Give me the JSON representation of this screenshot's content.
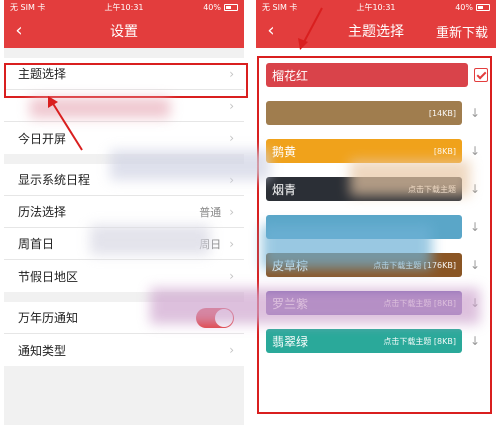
{
  "status": {
    "carrier": "无 SIM 卡",
    "time": "上午10:31",
    "battery": "40%"
  },
  "left": {
    "title": "设置",
    "groups": [
      [
        {
          "label": "主题选择"
        },
        {
          "label": ""
        },
        {
          "label": "今日开屏"
        }
      ],
      [
        {
          "label": "显示系统日程"
        },
        {
          "label": "历法选择",
          "value": "普通"
        },
        {
          "label": "周首日",
          "value": "周日"
        },
        {
          "label": "节假日地区"
        }
      ],
      [
        {
          "label": "万年历通知",
          "toggle": true
        },
        {
          "label": "通知类型"
        }
      ]
    ]
  },
  "right": {
    "title": "主题选择",
    "action": "重新下载",
    "themes": [
      {
        "name": "榴花红",
        "color": "#d9434a",
        "status": "",
        "selected": true
      },
      {
        "name": "",
        "color": "#a07d4e",
        "status": "[14KB]"
      },
      {
        "name": "鹅黄",
        "color": "#f0a21b",
        "status": "[8KB]"
      },
      {
        "name": "烟青",
        "color": "#2b2f36",
        "status": "点击下载主题"
      },
      {
        "name": "",
        "color": "#5aa6c8",
        "status": ""
      },
      {
        "name": "皮草棕",
        "color": "#8a5524",
        "status": "点击下载主题 [176KB]"
      },
      {
        "name": "罗兰紫",
        "color": "#7a5bb0",
        "status": "点击下载主题 [8KB]"
      },
      {
        "name": "翡翠绿",
        "color": "#2aa99a",
        "status": "点击下载主题 [8KB]"
      }
    ]
  },
  "icons": {
    "back": "‹",
    "chevron": "›",
    "download": "↓",
    "wifi": "◠"
  }
}
